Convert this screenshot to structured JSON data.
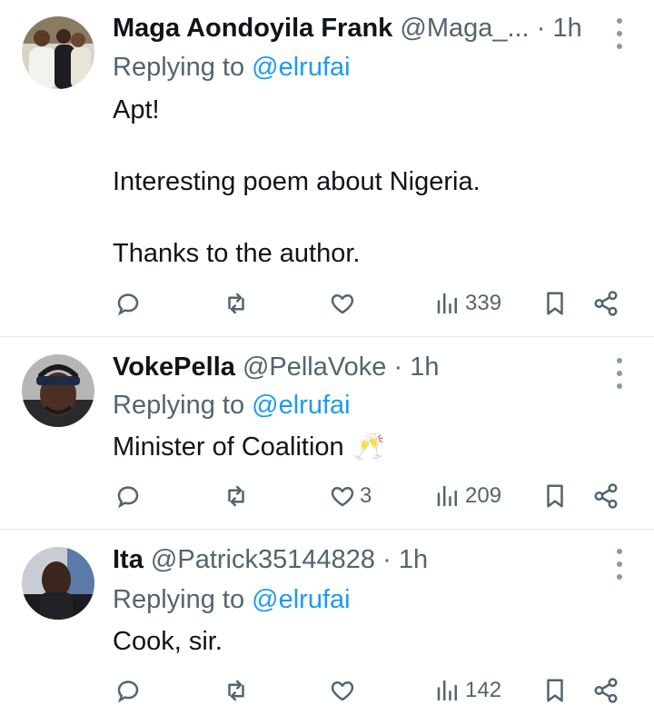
{
  "replies": [
    {
      "name": "Maga Aondoyila Frank",
      "handle": "@Maga_...",
      "time": "1h",
      "replying_prefix": "Replying to ",
      "replying_handle": "@elrufai",
      "lines": [
        "Apt!",
        "Interesting poem about Nigeria.",
        "Thanks to the author."
      ],
      "reply_count": "",
      "retweet_count": "",
      "like_count": "",
      "view_count": "339"
    },
    {
      "name": "VokePella",
      "handle": "@PellaVoke",
      "time": "1h",
      "replying_prefix": "Replying to ",
      "replying_handle": "@elrufai",
      "lines": [
        "Minister of Coalition"
      ],
      "emoji": "🥂",
      "reply_count": "",
      "retweet_count": "",
      "like_count": "3",
      "view_count": "209"
    },
    {
      "name": "Ita",
      "handle": "@Patrick35144828",
      "time": "1h",
      "replying_prefix": "Replying to ",
      "replying_handle": "@elrufai",
      "lines": [
        "Cook, sir."
      ],
      "reply_count": "",
      "retweet_count": "",
      "like_count": "",
      "view_count": "142"
    }
  ],
  "colors": {
    "text": "#0f1419",
    "secondary": "#536471",
    "mention": "#1d9bf0",
    "divider": "#e6e9ec"
  },
  "icons": [
    "reply-icon",
    "retweet-icon",
    "like-icon",
    "views-icon",
    "bookmark-icon",
    "share-icon",
    "more-icon"
  ]
}
